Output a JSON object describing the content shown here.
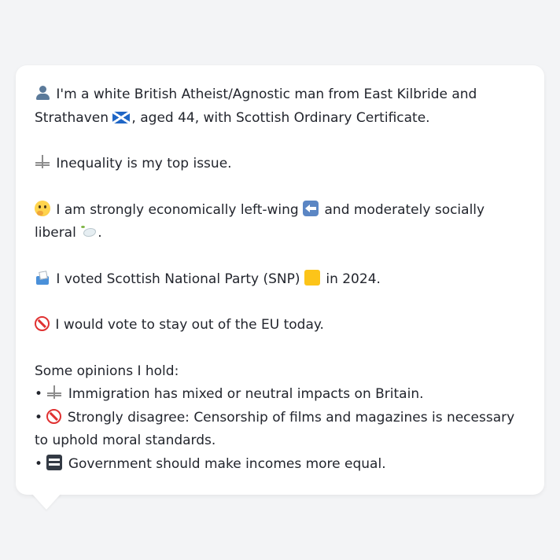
{
  "bio": {
    "intro": "I'm a white British Atheist/Agnostic man from East Kilbride and Strathaven",
    "intro_tail": ", aged 44, with Scottish Ordinary Certificate."
  },
  "top_issue": "Inequality is my top issue.",
  "ideology": {
    "part1": "I am strongly economically left-wing",
    "part2": "and moderately socially liberal",
    "part3": "."
  },
  "vote_2024": {
    "text": "I voted Scottish National Party (SNP)",
    "tail": "in 2024."
  },
  "eu_vote": "I would vote to stay out of the EU today.",
  "opinions": {
    "heading": "Some opinions I hold:",
    "bullet": "•",
    "items": [
      "Immigration has mixed or neutral impacts on Britain.",
      "Strongly disagree: Censorship of films and magazines is necessary to uphold moral standards.",
      "Government should make incomes more equal."
    ]
  },
  "colors": {
    "page_background": "#f3f4f6",
    "bubble_background": "#ffffff",
    "text": "#22252d"
  },
  "icons": [
    "person-icon",
    "flag-scotland-icon",
    "scales-icon",
    "thinking-face-icon",
    "left-arrow-icon",
    "dove-icon",
    "ballot-box-icon",
    "yellow-square-icon",
    "prohibited-icon",
    "equals-icon"
  ]
}
